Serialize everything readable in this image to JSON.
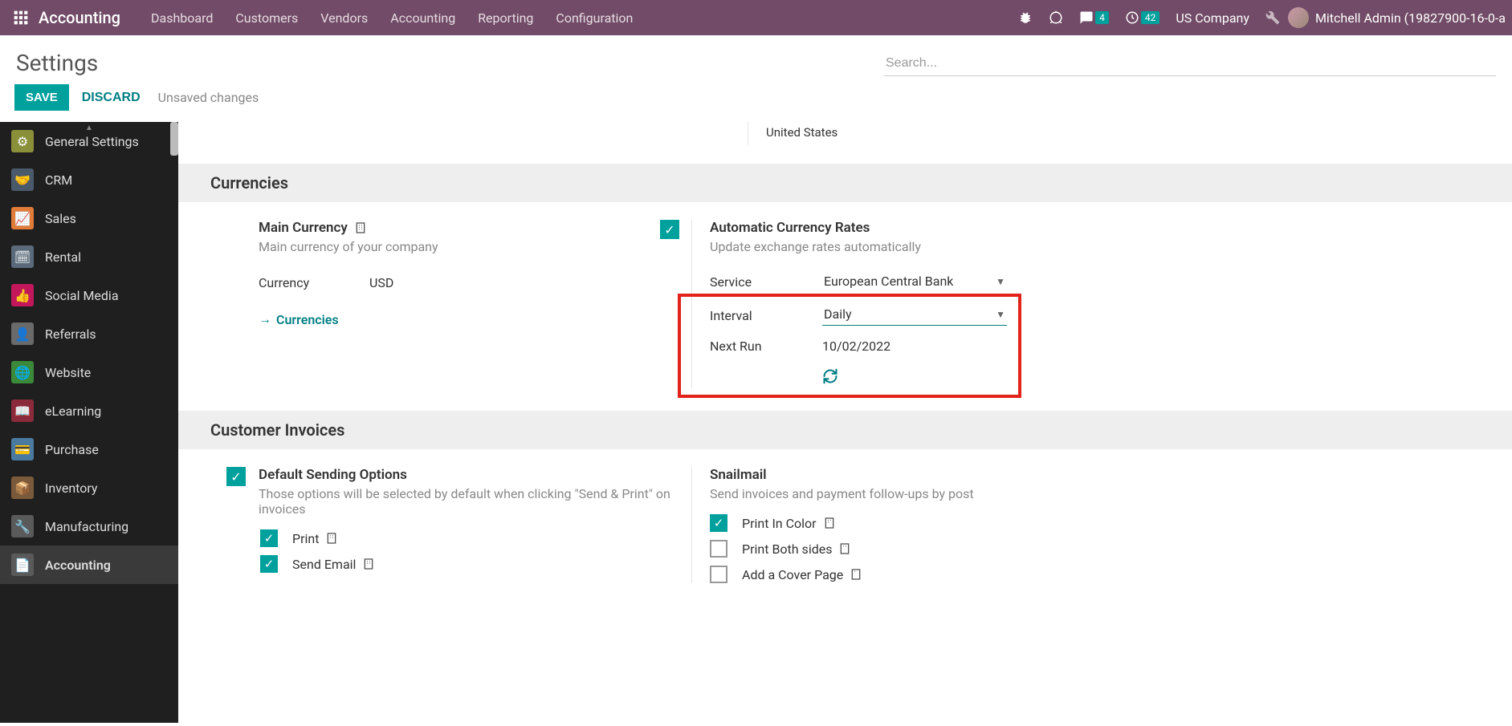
{
  "topnav": {
    "brand": "Accounting",
    "menu": [
      "Dashboard",
      "Customers",
      "Vendors",
      "Accounting",
      "Reporting",
      "Configuration"
    ],
    "messages_badge": "4",
    "activities_badge": "42",
    "company": "US Company",
    "user": "Mitchell Admin (19827900-16-0-a"
  },
  "header": {
    "title": "Settings",
    "search_placeholder": "Search..."
  },
  "actions": {
    "save": "SAVE",
    "discard": "DISCARD",
    "unsaved": "Unsaved changes"
  },
  "sidebar": {
    "items": [
      {
        "label": "General Settings",
        "icon": "gear",
        "bg": "#8a8f3a"
      },
      {
        "label": "CRM",
        "icon": "handshake",
        "bg": "#4a5a6a"
      },
      {
        "label": "Sales",
        "icon": "chart",
        "bg": "#e07b39"
      },
      {
        "label": "Rental",
        "icon": "calendar",
        "bg": "#5a6a7a"
      },
      {
        "label": "Social Media",
        "icon": "thumb",
        "bg": "#c2185b"
      },
      {
        "label": "Referrals",
        "icon": "person",
        "bg": "#6a6a6a"
      },
      {
        "label": "Website",
        "icon": "globe",
        "bg": "#3a8a3a"
      },
      {
        "label": "eLearning",
        "icon": "book",
        "bg": "#8a2a3a"
      },
      {
        "label": "Purchase",
        "icon": "card",
        "bg": "#4a7aa0"
      },
      {
        "label": "Inventory",
        "icon": "box",
        "bg": "#7a5a3a"
      },
      {
        "label": "Manufacturing",
        "icon": "wrench",
        "bg": "#5a5a5a"
      },
      {
        "label": "Accounting",
        "icon": "doc",
        "bg": "#5a5a5a"
      }
    ],
    "active_index": 11
  },
  "fragment": {
    "united_states": "United States"
  },
  "sections": {
    "currencies": {
      "title": "Currencies",
      "main_currency_label": "Main Currency",
      "main_currency_desc": "Main currency of your company",
      "currency_label": "Currency",
      "currency_value": "USD",
      "currencies_link": "Currencies",
      "auto_rates_label": "Automatic Currency Rates",
      "auto_rates_desc": "Update exchange rates automatically",
      "service_label": "Service",
      "service_value": "European Central Bank",
      "interval_label": "Interval",
      "interval_value": "Daily",
      "nextrun_label": "Next Run",
      "nextrun_value": "10/02/2022"
    },
    "invoices": {
      "title": "Customer Invoices",
      "default_sending_label": "Default Sending Options",
      "default_sending_desc": "Those options will be selected by default when clicking \"Send & Print\" on invoices",
      "opt_print": "Print",
      "opt_email": "Send Email",
      "snailmail_label": "Snailmail",
      "snailmail_desc": "Send invoices and payment follow-ups by post",
      "opt_color": "Print In Color",
      "opt_both": "Print Both sides",
      "opt_cover": "Add a Cover Page"
    }
  }
}
